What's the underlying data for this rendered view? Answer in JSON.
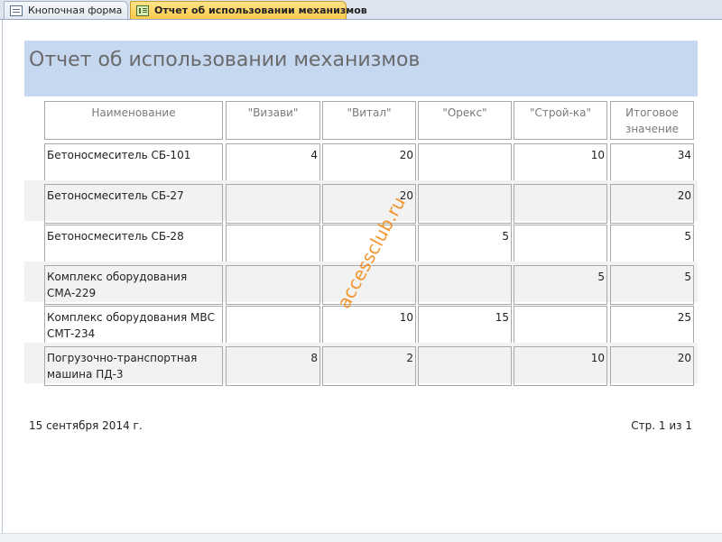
{
  "tabs": [
    {
      "label": "Кнопочная форма",
      "icon": "form-icon",
      "active": false
    },
    {
      "label": "Отчет об использовании механизмов",
      "icon": "report-icon",
      "active": true
    }
  ],
  "report": {
    "title": "Отчет об использовании механизмов",
    "columns": [
      "Наименование",
      "\"Визави\"",
      "\"Витал\"",
      "\"Орекс\"",
      "\"Строй-ка\"",
      "Итоговое значение"
    ],
    "rows": [
      [
        "Бетоносмеситель СБ-101",
        "4",
        "20",
        "",
        "10",
        "34"
      ],
      [
        "Бетоносмеситель СБ-27",
        "",
        "20",
        "",
        "",
        "20"
      ],
      [
        "Бетоносмеситель СБ-28",
        "",
        "",
        "5",
        "",
        "5"
      ],
      [
        "Комплекс оборудования СМА-229",
        "",
        "",
        "",
        "5",
        "5"
      ],
      [
        "Комплекс оборудования МВС СМТ-234",
        "",
        "10",
        "15",
        "",
        "25"
      ],
      [
        "Погрузочно-транспортная машина ПД-3",
        "8",
        "2",
        "",
        "10",
        "20"
      ]
    ],
    "footer_date": "15 сентября 2014 г.",
    "footer_page": "Стр. 1 из 1"
  },
  "watermark": "accessclub.ru",
  "colors": {
    "title_band": "#c6d8f0",
    "active_tab": "#fbc94a",
    "watermark": "#f28c1a"
  }
}
